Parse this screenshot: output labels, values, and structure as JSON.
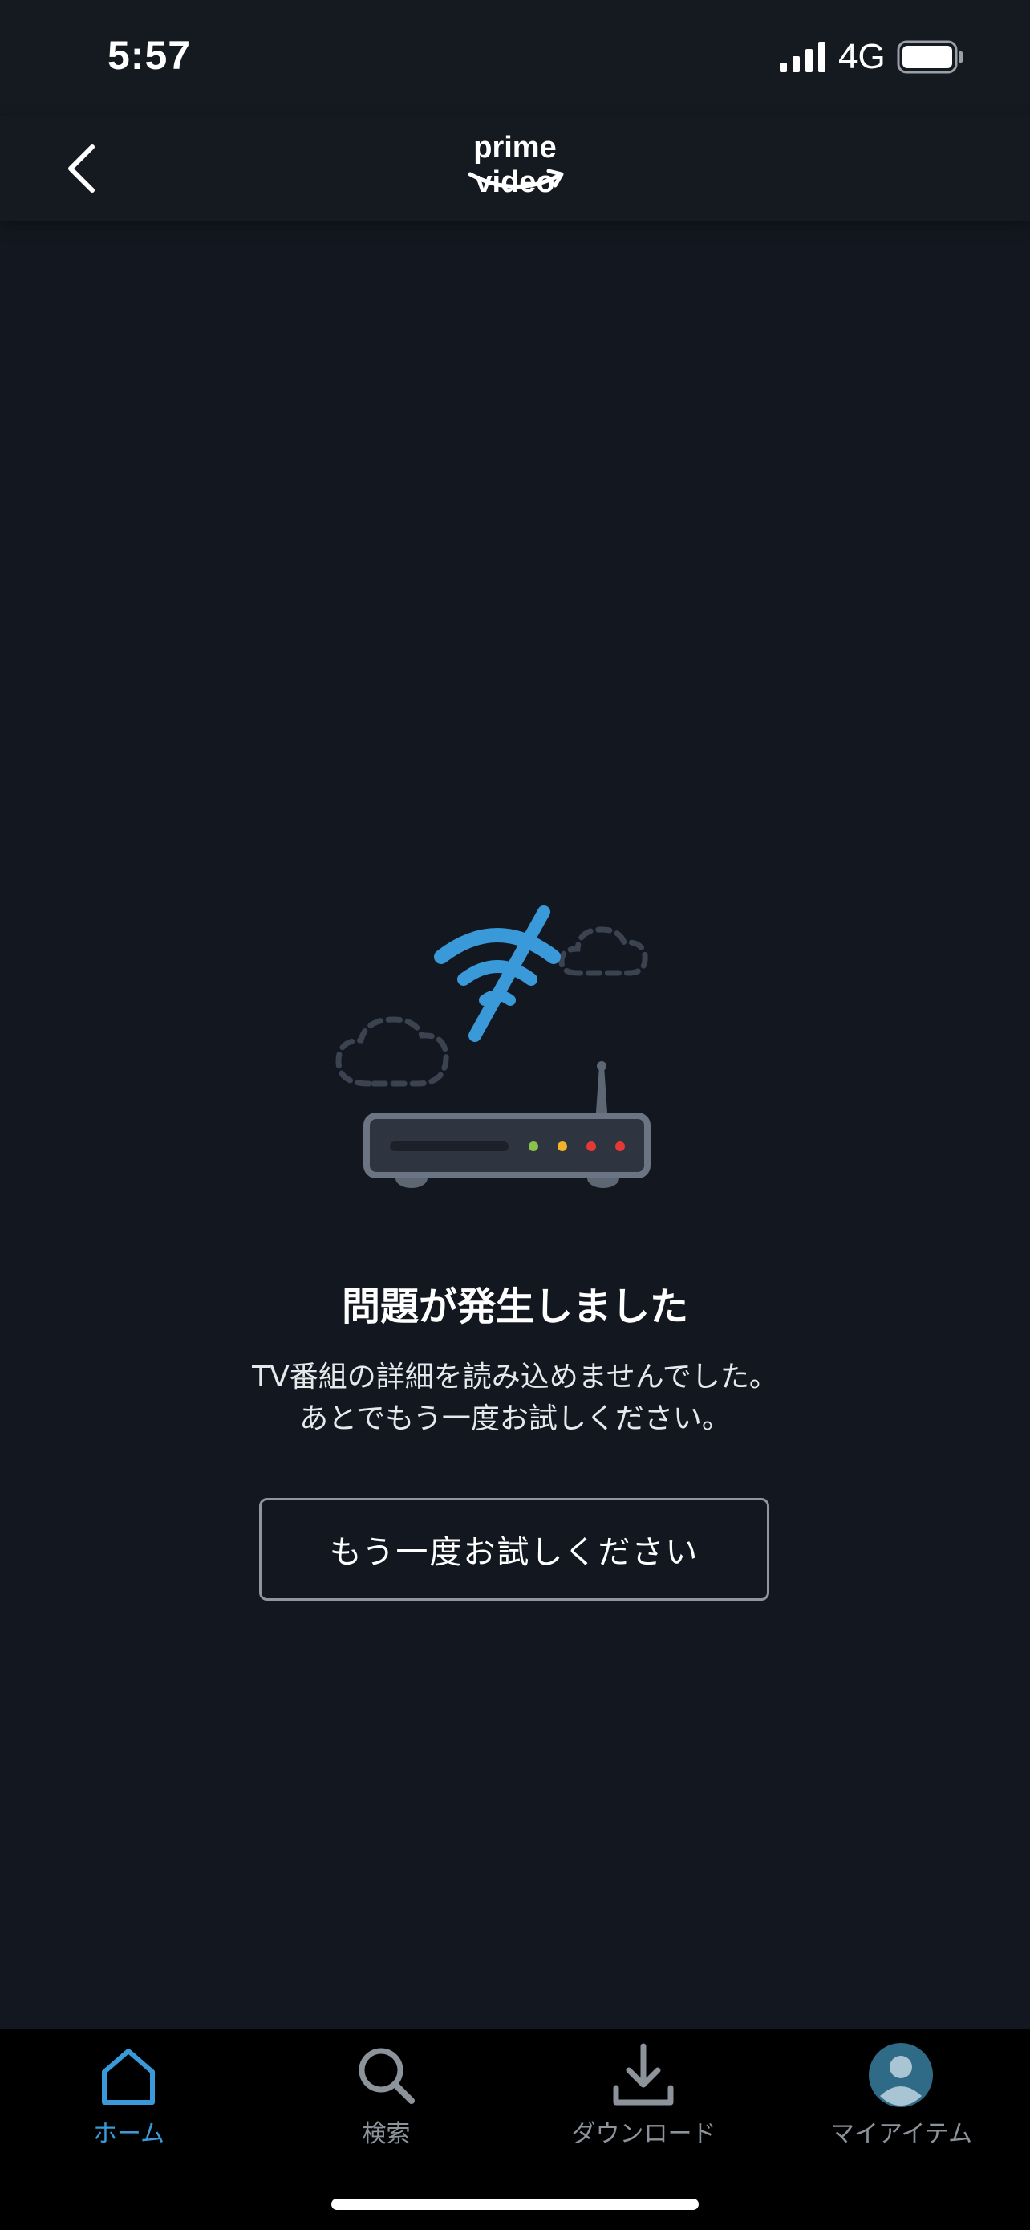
{
  "status_bar": {
    "time": "5:57",
    "network": "4G"
  },
  "header": {
    "logo_text": "prime video"
  },
  "error": {
    "title": "問題が発生しました",
    "message_line1": "TV番組の詳細を読み込めませんでした。",
    "message_line2": "あとでもう一度お試しください。",
    "retry_label": "もう一度お試しください"
  },
  "tabs": [
    {
      "label": "ホーム",
      "icon": "home-icon",
      "active": true
    },
    {
      "label": "検索",
      "icon": "search-icon",
      "active": false
    },
    {
      "label": "ダウンロード",
      "icon": "download-icon",
      "active": false
    },
    {
      "label": "マイアイテム",
      "icon": "avatar-icon",
      "active": false
    }
  ],
  "colors": {
    "background": "#131820",
    "accent": "#3a9ad9",
    "tab_inactive": "#8c939b",
    "button_border": "#8f969e"
  }
}
